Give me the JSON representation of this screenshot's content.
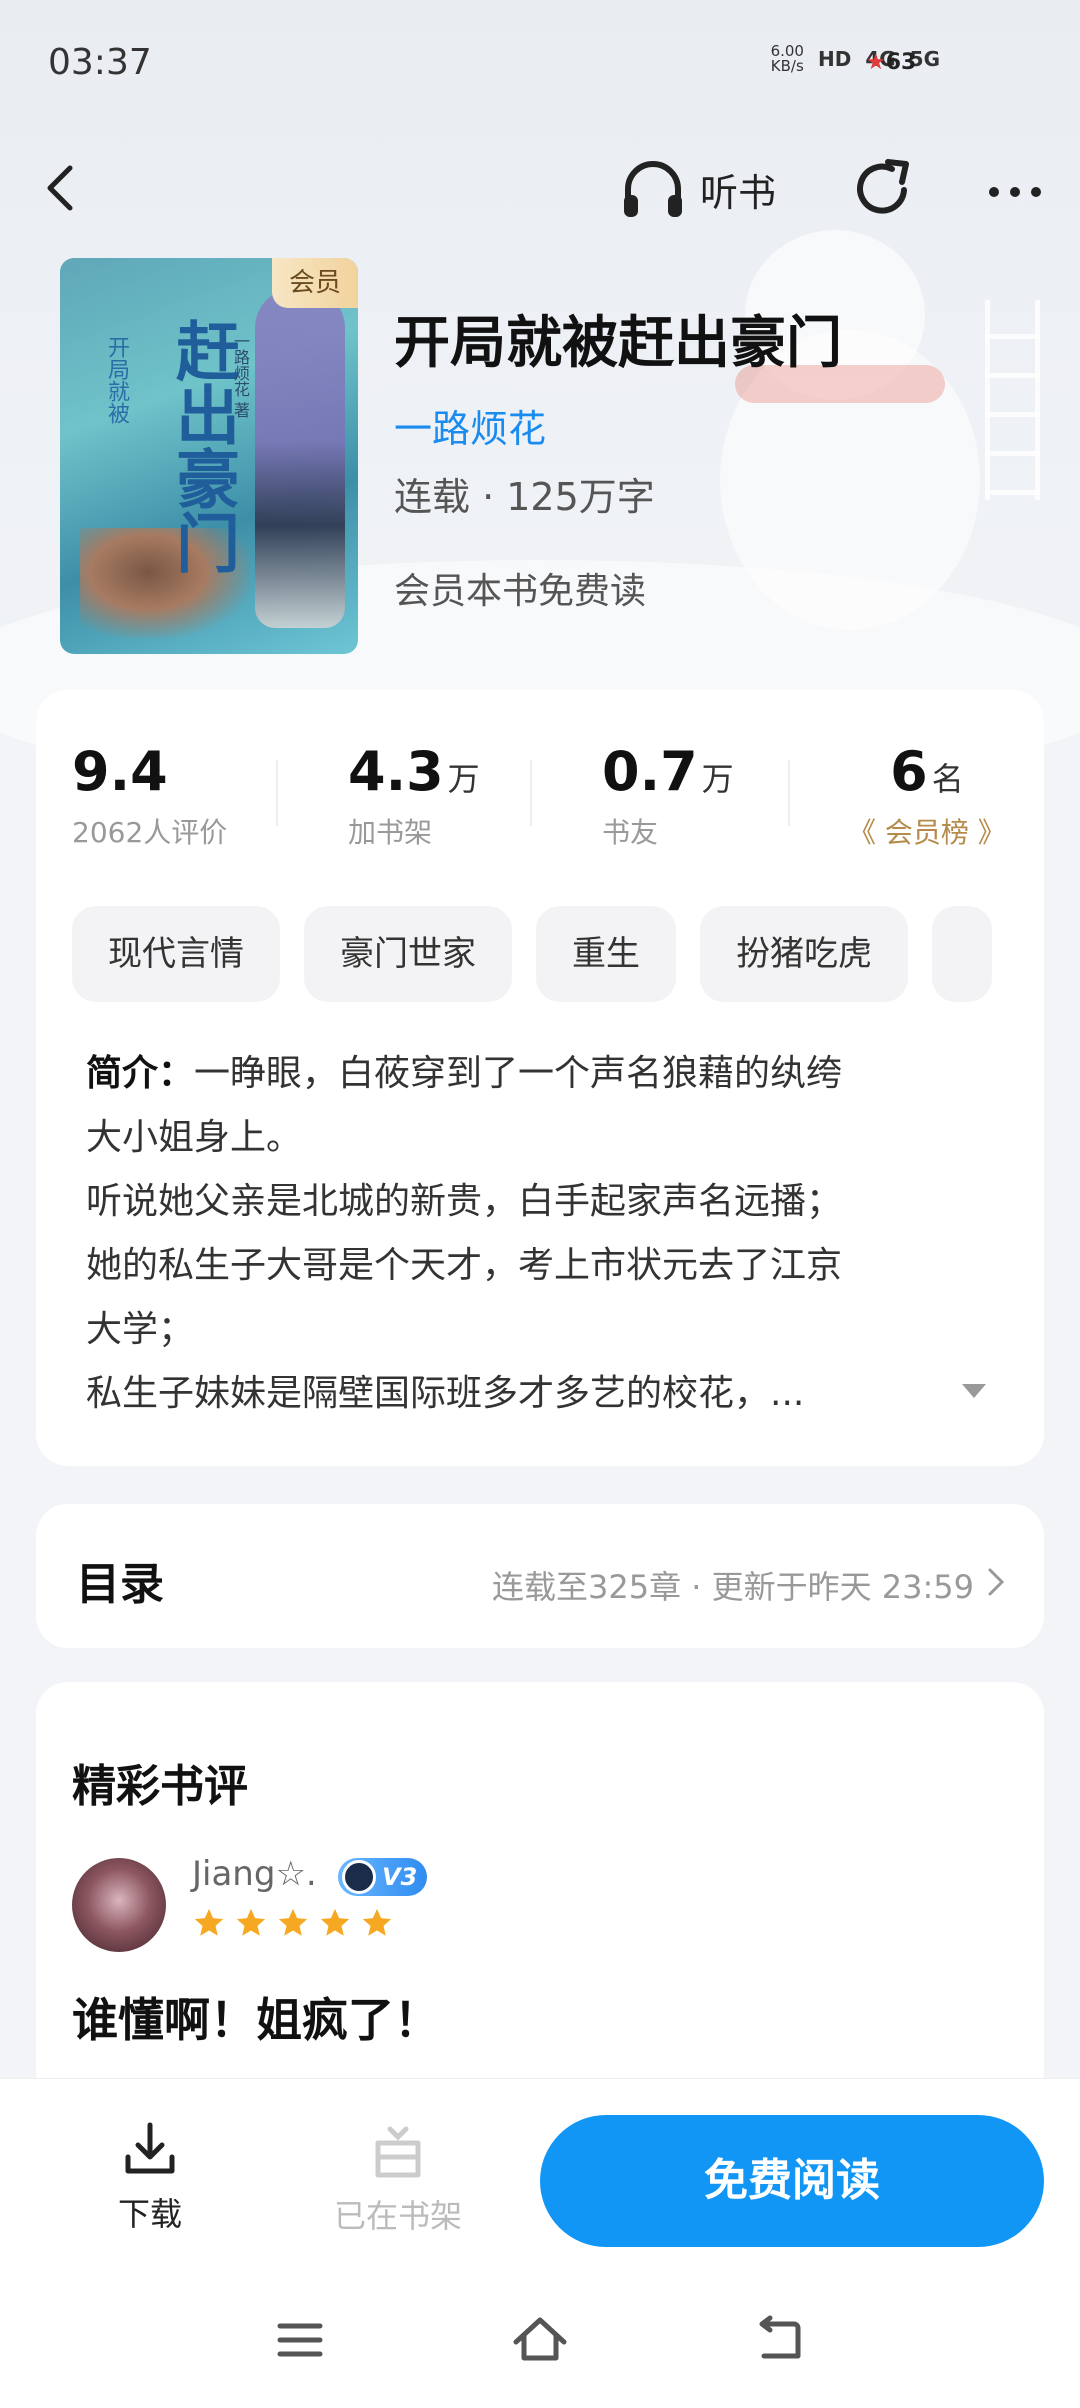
{
  "status_bar": {
    "time": "03:37",
    "net_speed_value": "6.00",
    "net_speed_unit": "KB/s",
    "hd": "HD",
    "net1": "4G",
    "net2": "5G",
    "battery": "63"
  },
  "nav": {
    "listen_label": "听书"
  },
  "book": {
    "cover_badge": "会员",
    "cover_title": "赶出豪门",
    "cover_subtitle": "开局就被",
    "cover_author": "一路烦花 著",
    "title": "开局就被赶出豪门",
    "author": "一路烦花",
    "meta": "连载 · 125万字",
    "free_note": "会员本书免费读"
  },
  "stats": [
    {
      "value": "9.4",
      "unit": "",
      "label": "2062人评价"
    },
    {
      "value": "4.3",
      "unit": "万",
      "label": "加书架"
    },
    {
      "value": "0.7",
      "unit": "万",
      "label": "书友"
    },
    {
      "value": "6",
      "unit": "名",
      "label": "《 会员榜 》"
    }
  ],
  "tags": [
    "现代言情",
    "豪门世家",
    "重生",
    "扮猪吃虎"
  ],
  "intro": {
    "label": "简介：",
    "lines": [
      "一睁眼，白莜穿到了一个声名狼藉的纨绔",
      "大小姐身上。",
      "听说她父亲是北城的新贵，白手起家声名远播；",
      "她的私生子大哥是个天才，考上市状元去了江京",
      "大学；",
      "私生子妹妹是隔壁国际班多才多艺的校花，..."
    ]
  },
  "toc": {
    "title": "目录",
    "meta": "连载至325章 · 更新于昨天 23:59"
  },
  "reviews": {
    "title": "精彩书评",
    "items": [
      {
        "user": "Jiang☆.",
        "level": "V3",
        "stars": 5,
        "text": "谁懂啊！姐疯了！"
      }
    ]
  },
  "bottom": {
    "download_label": "下载",
    "shelf_label": "已在书架",
    "read_label": "免费阅读"
  },
  "colors": {
    "accent": "#1296f5",
    "author_link": "#1a8cf0",
    "gold": "#b58a4a",
    "star": "#f7a823"
  }
}
